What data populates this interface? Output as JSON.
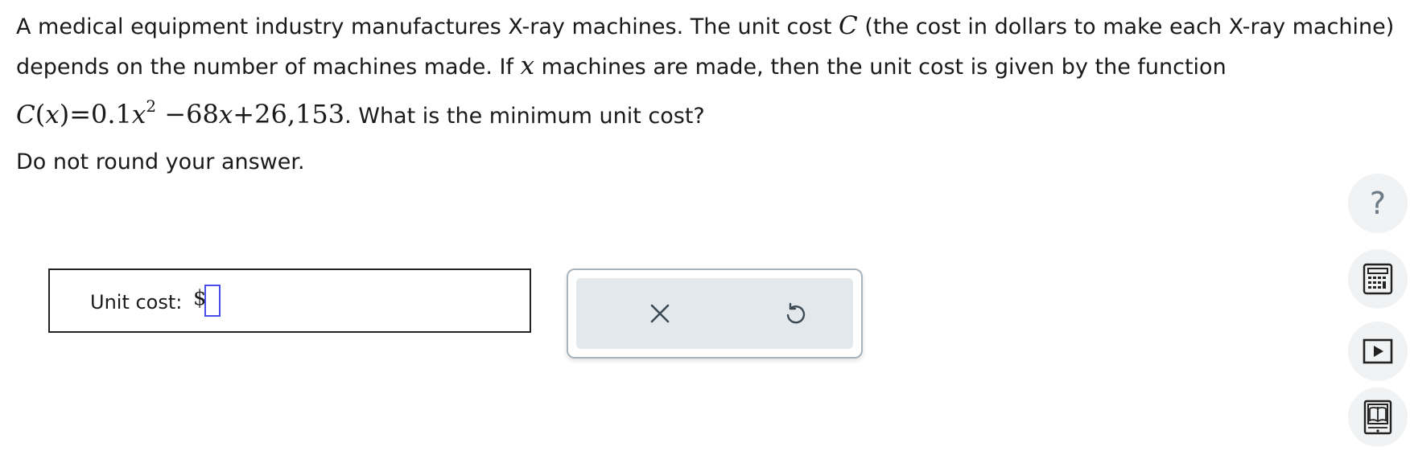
{
  "question": {
    "part1": "A medical equipment industry manufactures X-ray machines. The unit cost ",
    "var_C": "C",
    "part2": " (the cost in dollars to make each X-ray machine) depends on the number of machines made. If ",
    "var_x": "x",
    "part3": " machines are made, then the unit cost is given by the function ",
    "fn_C": "C",
    "fn_open": "(",
    "fn_x": "x",
    "fn_mid": ")=0.1",
    "fn_x2": "x",
    "fn_exp": "2",
    "fn_rest1": " −68",
    "fn_x3": "x",
    "fn_rest2": "+26,153",
    "part4": ". What is the minimum unit cost?"
  },
  "instruction": "Do not round your answer.",
  "answer": {
    "label": "Unit cost:",
    "prefix": "$",
    "value": ""
  },
  "actions": {
    "clear_icon": "close-icon",
    "undo_icon": "undo-icon"
  },
  "side_tools": [
    {
      "icon": "help-icon",
      "glyph": "?"
    },
    {
      "icon": "calculator-icon"
    },
    {
      "icon": "video-icon"
    },
    {
      "icon": "ebook-icon"
    }
  ],
  "colors": {
    "input_border": "#4a4ee8",
    "action_bg": "#e2e8ec",
    "side_button_bg": "#f0f2f3",
    "icon_gray": "#6b7a86"
  }
}
